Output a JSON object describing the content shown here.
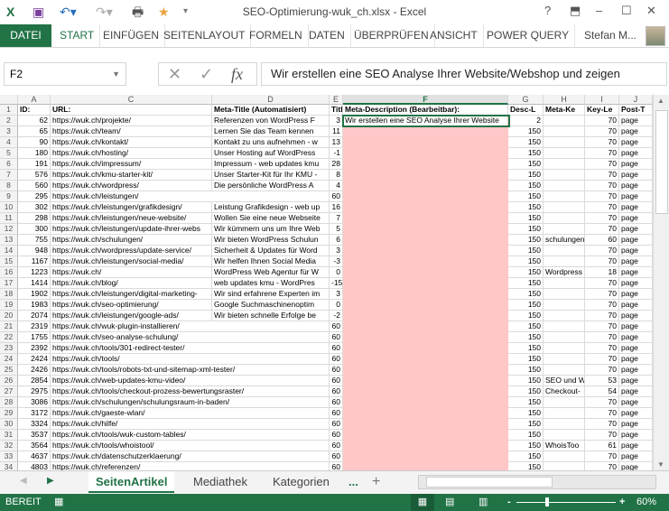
{
  "window": {
    "title": "SEO-Optimierung-wuk_ch.xlsx - Excel",
    "help": "?",
    "minimize": "–",
    "maximize": "☐",
    "close": "✕"
  },
  "ribbon": {
    "file": "DATEI",
    "tabs": [
      "START",
      "EINFÜGEN",
      "SEITENLAYOUT",
      "FORMELN",
      "DATEN",
      "ÜBERPRÜFEN",
      "ANSICHT",
      "POWER QUERY"
    ],
    "user": "Stefan M..."
  },
  "formula_bar": {
    "name_box": "F2",
    "cancel": "✕",
    "enter": "✓",
    "fx": "fx",
    "value": "Wir erstellen eine SEO Analyse Ihrer Website/Webshop und zeigen"
  },
  "columns": [
    "A",
    "C",
    "D",
    "E",
    "F",
    "G",
    "H",
    "I",
    "J"
  ],
  "header_row": {
    "row": "1",
    "cells": [
      "ID:",
      "URL:",
      "Meta-Title (Automatisiert)",
      "Title",
      "Meta-Description (Bearbeitbar):",
      "Desc-L",
      "Meta-Ke",
      "Key-Le",
      "Post-T"
    ]
  },
  "rows": [
    [
      "2",
      "62",
      "https://wuk.ch/projekte/",
      "Referenzen von WordPress F",
      "3",
      "Wir erstellen eine SEO Analyse Ihrer Website",
      "2",
      "",
      "70",
      "page"
    ],
    [
      "3",
      "65",
      "https://wuk.ch/team/",
      "Lernen Sie das Team kennen",
      "11",
      "",
      "150",
      "",
      "70",
      "page"
    ],
    [
      "4",
      "90",
      "https://wuk.ch/kontakt/",
      "Kontakt zu uns aufnehmen - w",
      "13",
      "",
      "150",
      "",
      "70",
      "page"
    ],
    [
      "5",
      "180",
      "https://wuk.ch/hosting/",
      "Unser Hosting auf WordPress",
      "-1",
      "",
      "150",
      "",
      "70",
      "page"
    ],
    [
      "6",
      "191",
      "https://wuk.ch/impressum/",
      "Impressum - web updates kmu",
      "28",
      "",
      "150",
      "",
      "70",
      "page"
    ],
    [
      "7",
      "576",
      "https://wuk.ch/kmu-starter-kit/",
      "Unser Starter-Kit für Ihr KMU -",
      "8",
      "",
      "150",
      "",
      "70",
      "page"
    ],
    [
      "8",
      "560",
      "https://wuk.ch/wordpress/",
      "Die persönliche WordPress A",
      "4",
      "",
      "150",
      "",
      "70",
      "page"
    ],
    [
      "9",
      "295",
      "https://wuk.ch/leistungen/",
      "",
      "60",
      "",
      "150",
      "",
      "70",
      "page"
    ],
    [
      "10",
      "302",
      "https://wuk.ch/leistungen/grafikdesign/",
      "Leistung Grafikdesign - web up",
      "16",
      "",
      "150",
      "",
      "70",
      "page"
    ],
    [
      "11",
      "298",
      "https://wuk.ch/leistungen/neue-website/",
      "Wollen Sie eine neue Webseite",
      "7",
      "",
      "150",
      "",
      "70",
      "page"
    ],
    [
      "12",
      "300",
      "https://wuk.ch/leistungen/update-ihrer-webs",
      "Wir kümmern uns um Ihre Web",
      "5",
      "",
      "150",
      "",
      "70",
      "page"
    ],
    [
      "13",
      "755",
      "https://wuk.ch/schulungen/",
      "Wir bieten WordPress Schulun",
      "6",
      "",
      "150",
      "schulungen",
      "60",
      "page"
    ],
    [
      "14",
      "948",
      "https://wuk.ch/wordpress/update-service/",
      "Sicherheit & Updates für Word",
      "3",
      "",
      "150",
      "",
      "70",
      "page"
    ],
    [
      "15",
      "1167",
      "https://wuk.ch/leistungen/social-media/",
      "Wir helfen Ihnen Social Media",
      "-3",
      "",
      "150",
      "",
      "70",
      "page"
    ],
    [
      "16",
      "1223",
      "https://wuk.ch/",
      "WordPress Web Agentur für W",
      "0",
      "",
      "150",
      "Wordpress",
      "18",
      "page"
    ],
    [
      "17",
      "1414",
      "https://wuk.ch/blog/",
      "web updates kmu - WordPres",
      "-15",
      "",
      "150",
      "",
      "70",
      "page"
    ],
    [
      "18",
      "1902",
      "https://wuk.ch/leistungen/digital-marketing-",
      "Wir sind erfahrene Experten im",
      "3",
      "",
      "150",
      "",
      "70",
      "page"
    ],
    [
      "19",
      "1983",
      "https://wuk.ch/seo-optimierung/",
      "Google Suchmaschinenoptim",
      "0",
      "",
      "150",
      "",
      "70",
      "page"
    ],
    [
      "20",
      "2074",
      "https://wuk.ch/leistungen/google-ads/",
      "Wir bieten schnelle Erfolge be",
      "-2",
      "",
      "150",
      "",
      "70",
      "page"
    ],
    [
      "21",
      "2319",
      "https://wuk.ch/wuk-plugin-installieren/",
      "",
      "60",
      "",
      "150",
      "",
      "70",
      "page"
    ],
    [
      "22",
      "1755",
      "https://wuk.ch/seo-analyse-schulung/",
      "",
      "60",
      "",
      "150",
      "",
      "70",
      "page"
    ],
    [
      "23",
      "2392",
      "https://wuk.ch/tools/301-redirect-tester/",
      "",
      "60",
      "",
      "150",
      "",
      "70",
      "page"
    ],
    [
      "24",
      "2424",
      "https://wuk.ch/tools/",
      "",
      "60",
      "",
      "150",
      "",
      "70",
      "page"
    ],
    [
      "25",
      "2426",
      "https://wuk.ch/tools/robots-txt-und-sitemap-xml-tester/",
      "",
      "60",
      "",
      "150",
      "",
      "70",
      "page"
    ],
    [
      "26",
      "2854",
      "https://wuk.ch/web-updates-kmu-video/",
      "",
      "60",
      "",
      "150",
      "SEO und W",
      "53",
      "page"
    ],
    [
      "27",
      "2975",
      "https://wuk.ch/tools/checkout-prozess-bewertungsraster/",
      "",
      "60",
      "",
      "150",
      "Checkout-",
      "54",
      "page"
    ],
    [
      "28",
      "3086",
      "https://wuk.ch/schulungen/schulungsraum-in-baden/",
      "",
      "60",
      "",
      "150",
      "",
      "70",
      "page"
    ],
    [
      "29",
      "3172",
      "https://wuk.ch/gaeste-wlan/",
      "",
      "60",
      "",
      "150",
      "",
      "70",
      "page"
    ],
    [
      "30",
      "3324",
      "https://wuk.ch/hilfe/",
      "",
      "60",
      "",
      "150",
      "",
      "70",
      "page"
    ],
    [
      "31",
      "3537",
      "https://wuk.ch/tools/wuk-custom-tables/",
      "",
      "60",
      "",
      "150",
      "",
      "70",
      "page"
    ],
    [
      "32",
      "3564",
      "https://wuk.ch/tools/whoistool/",
      "",
      "60",
      "",
      "150",
      "WhoisToo",
      "61",
      "page"
    ],
    [
      "33",
      "4637",
      "https://wuk.ch/datenschutzerklaerung/",
      "",
      "60",
      "",
      "150",
      "",
      "70",
      "page"
    ],
    [
      "34",
      "4803",
      "https://wuk.ch/referenzen/",
      "",
      "60",
      "",
      "150",
      "",
      "70",
      "page"
    ]
  ],
  "sheet_tabs": {
    "tabs": [
      "SeitenArtikel",
      "Mediathek",
      "Kategorien"
    ],
    "more": "...",
    "add": "+"
  },
  "status": {
    "ready": "BEREIT",
    "zoom": "60%"
  },
  "colors": {
    "accent": "#217346",
    "highlight": "#ffc7c7"
  }
}
